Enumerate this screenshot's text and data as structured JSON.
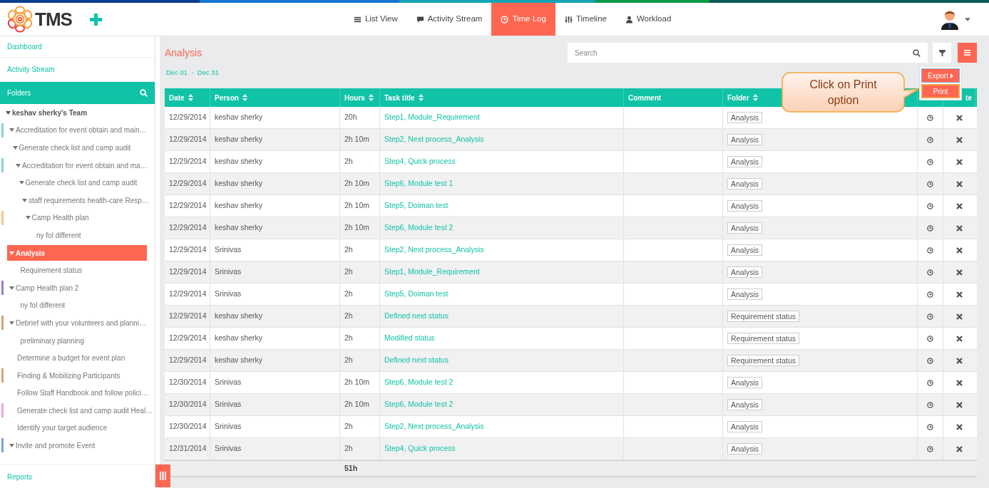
{
  "header": {
    "logo_text": "TMS",
    "nav": [
      {
        "label": "List View",
        "selected": false
      },
      {
        "label": "Activity Stream",
        "selected": false
      },
      {
        "label": "Time Log",
        "selected": true
      },
      {
        "label": "Timeline",
        "selected": false
      },
      {
        "label": "Workload",
        "selected": false
      }
    ]
  },
  "sidebar": {
    "links": [
      "Dashboard",
      "Activity Stream"
    ],
    "folders_title": "Folders",
    "footer_link": "Reports",
    "tree": [
      {
        "label": "keshav sherky's Team",
        "expanded": true,
        "selected": false,
        "children": [
          {
            "label": "Accreditation for event obtain and main…",
            "color": "#8fd0d6",
            "expanded": true,
            "selected": false,
            "children": [
              {
                "label": "Generate check list and camp audit",
                "expanded": true,
                "selected": false,
                "children": [
                  {
                    "label": "Accreditation for event obtain and ma…",
                    "color": "#8fd0d6",
                    "expanded": true,
                    "selected": false,
                    "children": [
                      {
                        "label": "Generate check list and camp audit",
                        "expanded": true,
                        "selected": false,
                        "children": [
                          {
                            "label": "staff requirements health-care Resp…",
                            "expanded": true,
                            "selected": false,
                            "children": [
                              {
                                "label": "Camp Health plan",
                                "color": "#f9c48e",
                                "expanded": true,
                                "selected": false,
                                "children": [
                                  {
                                    "label": "ny fol different",
                                    "expanded": false,
                                    "selected": false
                                  }
                                ]
                              }
                            ]
                          }
                        ]
                      }
                    ]
                  }
                ]
              }
            ]
          },
          {
            "label": "Analysis",
            "expanded": true,
            "selected": true,
            "children": [
              {
                "label": "Requirement status",
                "expanded": false,
                "selected": false
              }
            ]
          },
          {
            "label": "Camp Health plan 2",
            "color": "#9b7fd0",
            "expanded": true,
            "selected": false,
            "children": [
              {
                "label": "ny fol different",
                "expanded": false,
                "selected": false
              }
            ]
          },
          {
            "label": "Debrief with your volunteers and planni…",
            "color": "#d2a57e",
            "expanded": true,
            "selected": false,
            "children": [
              {
                "label": "preliminary planning",
                "expanded": false,
                "selected": false
              }
            ]
          },
          {
            "label": "Determine a budget for event plan",
            "expanded": false,
            "selected": false
          },
          {
            "label": "Finding & Mobilizing Participants",
            "color": "#d2a57e",
            "expanded": false,
            "selected": false
          },
          {
            "label": "Follow Staff Handbook and follow polici…",
            "expanded": false,
            "selected": false
          },
          {
            "label": "Generate check list and camp audit Heal…",
            "color": "#f0a8e0",
            "expanded": false,
            "selected": false
          },
          {
            "label": "Identify your target audience",
            "expanded": false,
            "selected": false
          },
          {
            "label": "Invite and promote Event",
            "color": "#7f9fd6",
            "expanded": true,
            "selected": false
          }
        ]
      }
    ]
  },
  "main": {
    "title": "Analysis",
    "search": {
      "placeholder": "Search"
    },
    "date_range": "Dec 01  -  Dec 31",
    "menu": [
      {
        "label": "Export",
        "kind": "submenu",
        "selected": false
      },
      {
        "label": "Print",
        "kind": "item",
        "selected": true
      }
    ],
    "callout": "Click on Print option",
    "table": {
      "columns": [
        {
          "label": "Date",
          "sortable": true
        },
        {
          "label": "Person",
          "sortable": true
        },
        {
          "label": "Hours",
          "sortable": true
        },
        {
          "label": "Task title",
          "sortable": true
        },
        {
          "label": "Comment",
          "sortable": false
        },
        {
          "label": "Folder",
          "sortable": true
        },
        {
          "label": "te",
          "sortable": false
        }
      ],
      "rows": [
        {
          "date": "12/29/2014",
          "person": "keshav sherky",
          "hours": "20h",
          "task": "Step1, Module_Requirement",
          "folder": "Analysis"
        },
        {
          "date": "12/29/2014",
          "person": "keshav sherky",
          "hours": "2h 10m",
          "task": "Step2, Next process_Analysis",
          "folder": "Analysis"
        },
        {
          "date": "12/29/2014",
          "person": "keshav sherky",
          "hours": "2h",
          "task": "Step4, Quick process",
          "folder": "Analysis"
        },
        {
          "date": "12/29/2014",
          "person": "keshav sherky",
          "hours": "2h 10m",
          "task": "Step6, Module test 1",
          "folder": "Analysis"
        },
        {
          "date": "12/29/2014",
          "person": "keshav sherky",
          "hours": "2h 10m",
          "task": "Step5, Doiman test",
          "folder": "Analysis"
        },
        {
          "date": "12/29/2014",
          "person": "keshav sherky",
          "hours": "2h 10m",
          "task": "Step6, Module test 2",
          "folder": "Analysis"
        },
        {
          "date": "12/29/2014",
          "person": "Srinivas",
          "hours": "2h",
          "task": "Step2, Next process_Analysis",
          "folder": "Analysis"
        },
        {
          "date": "12/29/2014",
          "person": "Srinivas",
          "hours": "2h",
          "task": "Step1, Module_Requirement",
          "folder": "Analysis"
        },
        {
          "date": "12/29/2014",
          "person": "Srinivas",
          "hours": "2h",
          "task": "Step5, Doiman test",
          "folder": "Analysis"
        },
        {
          "date": "12/29/2014",
          "person": "keshav sherky",
          "hours": "2h",
          "task": "Defined next status",
          "folder": "Requirement status"
        },
        {
          "date": "12/29/2014",
          "person": "keshav sherky",
          "hours": "2h",
          "task": "Modified status",
          "folder": "Requirement status"
        },
        {
          "date": "12/29/2014",
          "person": "keshav sherky",
          "hours": "2h",
          "task": "Defined next status",
          "folder": "Requirement status"
        },
        {
          "date": "12/30/2014",
          "person": "Srinivas",
          "hours": "2h 10m",
          "task": "Step6, Module test 2",
          "folder": "Analysis"
        },
        {
          "date": "12/30/2014",
          "person": "Srinivas",
          "hours": "2h 10m",
          "task": "Step6, Module test 2",
          "folder": "Analysis"
        },
        {
          "date": "12/30/2014",
          "person": "Srinivas",
          "hours": "2h",
          "task": "Step2, Next process_Analysis",
          "folder": "Analysis"
        },
        {
          "date": "12/31/2014",
          "person": "Srinivas",
          "hours": "2h",
          "task": "Step4, Quick process",
          "folder": "Analysis"
        }
      ],
      "total": "51h"
    }
  }
}
